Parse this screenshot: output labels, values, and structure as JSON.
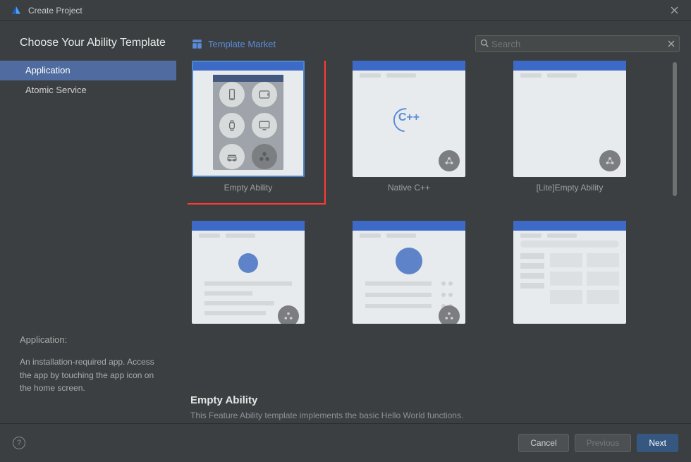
{
  "window": {
    "title": "Create Project"
  },
  "page": {
    "heading": "Choose Your Ability Template"
  },
  "sidebar": {
    "app_types": [
      {
        "label": "Application",
        "selected": true
      },
      {
        "label": "Atomic Service",
        "selected": false
      }
    ],
    "desc_label": "Application:",
    "desc_body": "An installation-required app. Access the app by touching the app icon on the home screen."
  },
  "content": {
    "market_label": "Template Market",
    "search": {
      "placeholder": "Search",
      "value": ""
    },
    "templates": [
      {
        "label": "Empty Ability",
        "selected": true
      },
      {
        "label": "Native C++",
        "selected": false
      },
      {
        "label": "[Lite]Empty Ability",
        "selected": false
      }
    ],
    "detail": {
      "title": "Empty Ability",
      "desc": "This Feature Ability template implements the basic Hello World functions."
    }
  },
  "footer": {
    "cancel": "Cancel",
    "previous": "Previous",
    "next": "Next"
  }
}
